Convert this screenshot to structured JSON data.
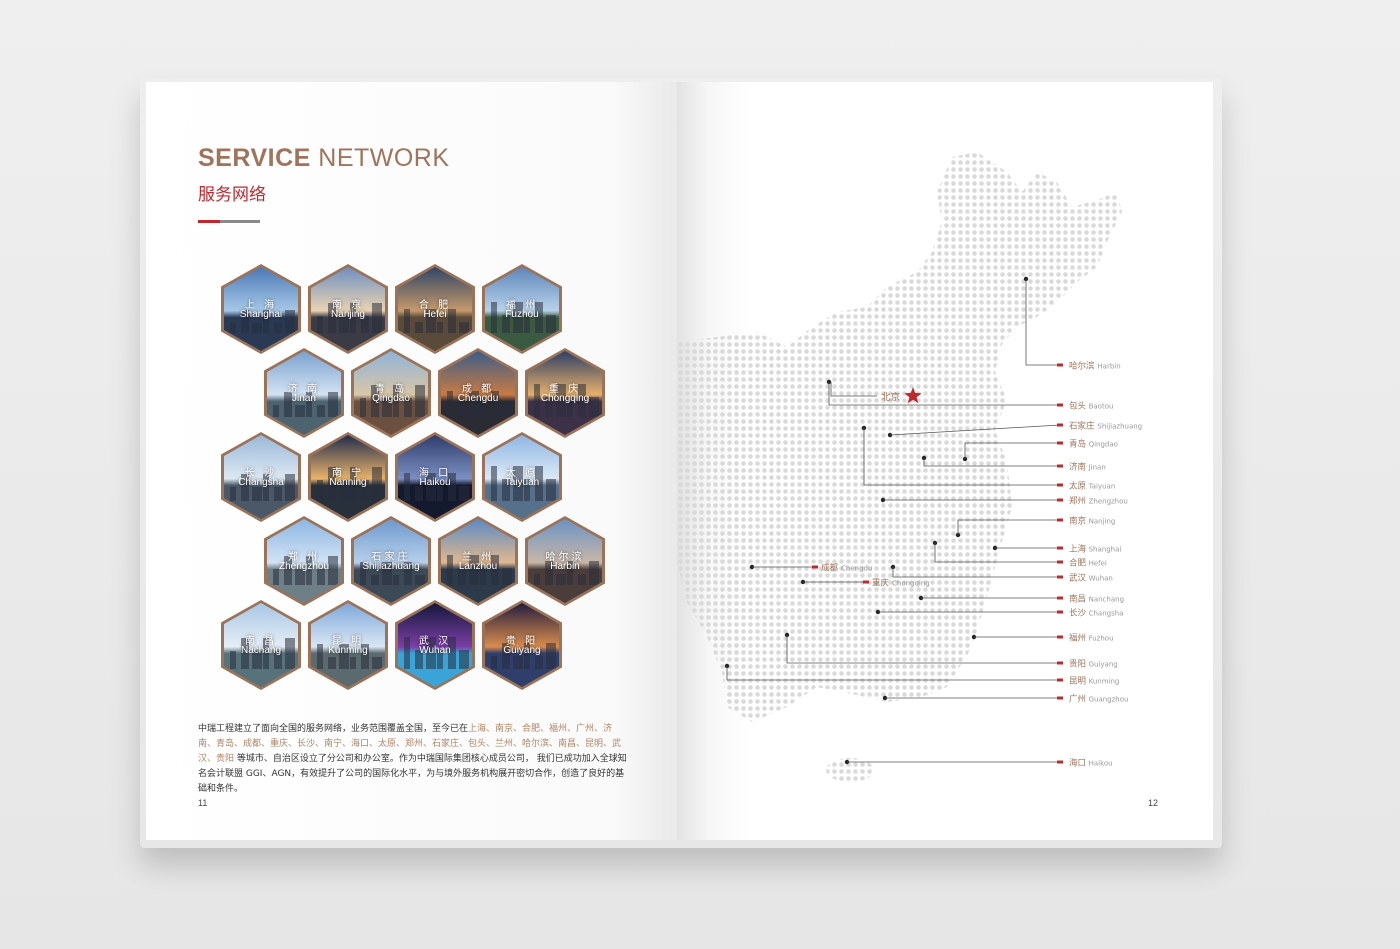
{
  "left_page": {
    "title_en_bold": "SERVICE",
    "title_en_light": "NETWORK",
    "title_cn": "服务网络",
    "page_number": "11",
    "body": [
      {
        "t": "中瑞工程建立了面向全国的服务网络，业务范围覆盖全国，至今已在",
        "h": false
      },
      {
        "t": "上海、南京、合肥、福州、广州、济南、青岛、成都、重庆、长沙、南宁、海口、太原、郑州、石家庄、包头、兰州、哈尔滨、南昌、昆明、武汉、贵阳",
        "h": true
      },
      {
        "t": " 等城市、自治区设立了分公司和办公室。作为中瑞国际集团核心成员公司， 我们已成功加入全球知名会计联盟 GGI、AGN，有效提升了公司的国际化水平，为与境外服务机构展开密切合作，创造了良好的基础和条件。",
        "h": false
      }
    ],
    "hexes": [
      {
        "cn": "上 海",
        "en": "Shanghai"
      },
      {
        "cn": "南 京",
        "en": "Nanjing"
      },
      {
        "cn": "合 肥",
        "en": "Hefei"
      },
      {
        "cn": "福 州",
        "en": "Fuzhou"
      },
      {
        "cn": "济 南",
        "en": "Jinan"
      },
      {
        "cn": "青 岛",
        "en": "Qingdao"
      },
      {
        "cn": "成 都",
        "en": "Chengdu"
      },
      {
        "cn": "重 庆",
        "en": "Chongqing"
      },
      {
        "cn": "长 沙",
        "en": "Changsha"
      },
      {
        "cn": "南 宁",
        "en": "Nanning"
      },
      {
        "cn": "海 口",
        "en": "Haikou"
      },
      {
        "cn": "太 原",
        "en": "Taiyuan"
      },
      {
        "cn": "郑 州",
        "en": "Zhengzhou"
      },
      {
        "cn": "石家庄",
        "en": "Shijiazhuang"
      },
      {
        "cn": "兰 州",
        "en": "Lanzhou"
      },
      {
        "cn": "哈尔滨",
        "en": "Harbin"
      },
      {
        "cn": "南 昌",
        "en": "Nachang"
      },
      {
        "cn": "昆 明",
        "en": "Kunming"
      },
      {
        "cn": "武 汉",
        "en": "Wuhan"
      },
      {
        "cn": "贵 阳",
        "en": "Guiyang"
      }
    ]
  },
  "right_page": {
    "page_number": "12",
    "capital": {
      "cn": "北京"
    },
    "right_labels": [
      {
        "cn": "哈尔滨",
        "en": "Harbin"
      },
      {
        "cn": "包头",
        "en": "Baotou"
      },
      {
        "cn": "石家庄",
        "en": "Shijiazhuang"
      },
      {
        "cn": "青岛",
        "en": "Qingdao"
      },
      {
        "cn": "济南",
        "en": "Jinan"
      },
      {
        "cn": "太原",
        "en": "Taiyuan"
      },
      {
        "cn": "郑州",
        "en": "Zhengzhou"
      },
      {
        "cn": "南京",
        "en": "Nanjing"
      },
      {
        "cn": "上海",
        "en": "Shanghai"
      },
      {
        "cn": "合肥",
        "en": "Hefei"
      },
      {
        "cn": "武汉",
        "en": "Wuhan"
      },
      {
        "cn": "南昌",
        "en": "Nanchang"
      },
      {
        "cn": "长沙",
        "en": "Changsha"
      },
      {
        "cn": "福州",
        "en": "Fuzhou"
      },
      {
        "cn": "贵阳",
        "en": "Guiyang"
      },
      {
        "cn": "昆明",
        "en": "Kunming"
      },
      {
        "cn": "广州",
        "en": "Guangzhou"
      },
      {
        "cn": "海口",
        "en": "Haikou"
      }
    ],
    "left_labels": [
      {
        "cn": "成都",
        "en": "Chengdu"
      },
      {
        "cn": "重庆",
        "en": "Chongqing"
      }
    ],
    "colors": {
      "accent": "#c0282e",
      "brown": "#a0735b",
      "line": "#555555"
    }
  }
}
